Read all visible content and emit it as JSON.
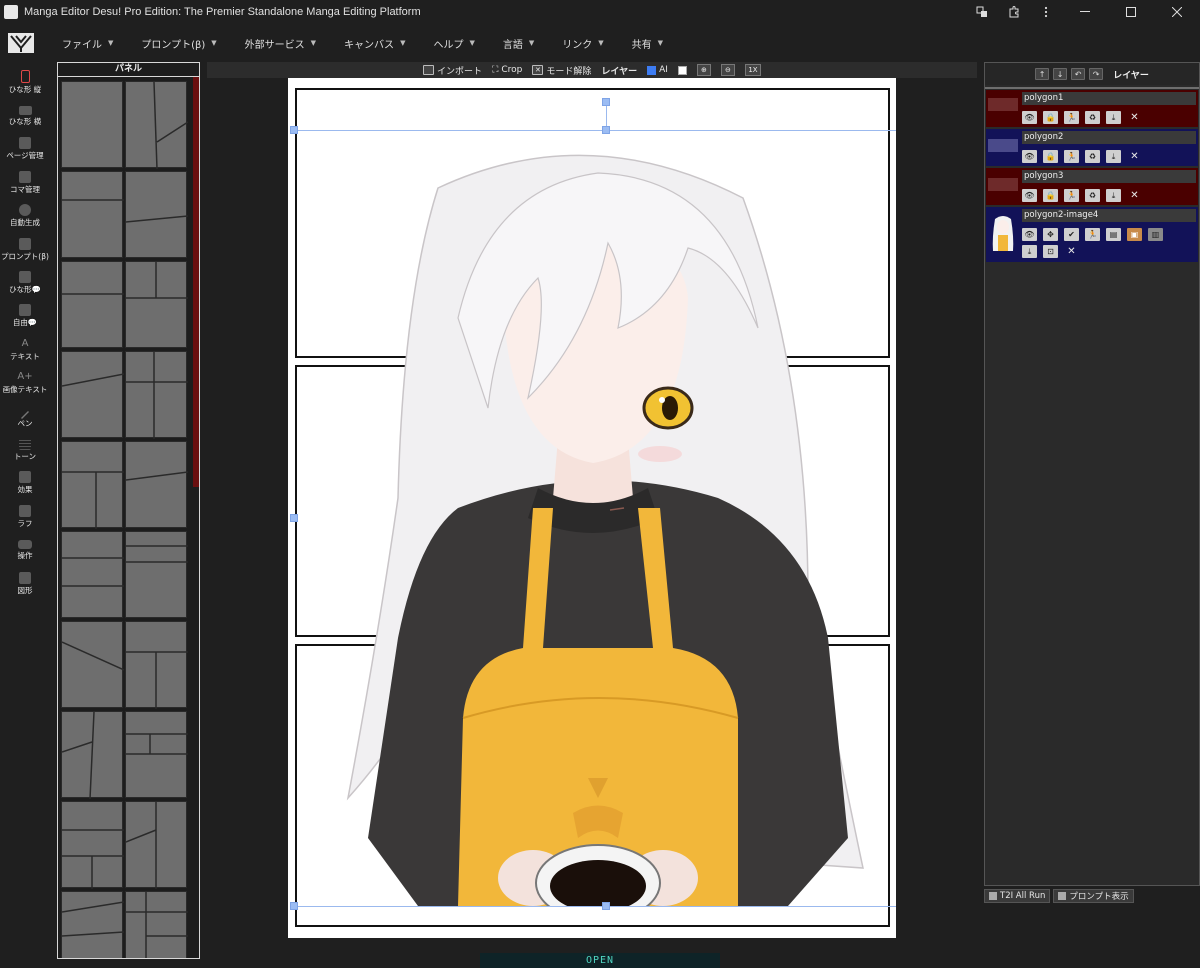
{
  "window": {
    "title": "Manga Editor Desu! Pro Edition: The Premier Standalone Manga Editing Platform",
    "controls": [
      "translate-icon",
      "extension-icon",
      "more-icon",
      "minimize",
      "maximize",
      "close"
    ]
  },
  "menu": [
    {
      "label": "ファイル"
    },
    {
      "label": "プロンプト(β)"
    },
    {
      "label": "外部サービス"
    },
    {
      "label": "キャンバス"
    },
    {
      "label": "ヘルプ"
    },
    {
      "label": "言語"
    },
    {
      "label": "リンク"
    },
    {
      "label": "共有"
    }
  ],
  "tools": [
    {
      "label": "ひな形 縦",
      "icon": "portrait-template-icon",
      "active": true
    },
    {
      "label": "ひな形 横",
      "icon": "landscape-template-icon"
    },
    {
      "label": "ページ管理",
      "icon": "page-manage-icon"
    },
    {
      "label": "コマ管理",
      "icon": "panel-manage-icon"
    },
    {
      "label": "自動生成",
      "icon": "robot-icon"
    },
    {
      "label": "プロンプト(β)",
      "icon": "clipboard-icon"
    },
    {
      "label": "ひな形💬",
      "icon": "bubble-template-icon"
    },
    {
      "label": "自由💬",
      "icon": "free-bubble-icon"
    },
    {
      "label": "テキスト",
      "icon": "text-icon"
    },
    {
      "label": "画像テキスト",
      "icon": "image-text-icon"
    },
    {
      "label": "ペン",
      "icon": "pen-icon"
    },
    {
      "label": "トーン",
      "icon": "tone-icon"
    },
    {
      "label": "効果",
      "icon": "effect-icon"
    },
    {
      "label": "ラフ",
      "icon": "rough-icon"
    },
    {
      "label": "操作",
      "icon": "gamepad-icon"
    },
    {
      "label": "図形",
      "icon": "shapes-icon"
    }
  ],
  "panel": {
    "title": "パネル"
  },
  "canvas_toolbar": {
    "import_label": "インポート",
    "crop_label": "Crop",
    "mode_release_label": "モード解除",
    "layer_label": "レイヤー",
    "ai_label": "AI",
    "ai_checked": true,
    "extra_checked": false,
    "zoom_reset_label": "1X"
  },
  "layers": {
    "title": "レイヤー",
    "items": [
      {
        "name": "polygon1",
        "swatch": "#6e2a2a",
        "bg": "#4a0000"
      },
      {
        "name": "polygon2",
        "swatch": "#4a4a8a",
        "bg": "#121258"
      },
      {
        "name": "polygon3",
        "swatch": "#6e2a2a",
        "bg": "#4a0000"
      },
      {
        "name": "polygon2-image4",
        "bg": "#121258"
      }
    ]
  },
  "bottom_buttons": {
    "t2i_label": "T2I All Run",
    "prompt_label": "プロンプト表示"
  },
  "status": {
    "open_label": "OPEN"
  },
  "colors": {
    "accent_blue": "#3d7cf2",
    "layer_red": "#4a0000",
    "layer_blue": "#121258",
    "open_text": "#4fd6c2"
  }
}
